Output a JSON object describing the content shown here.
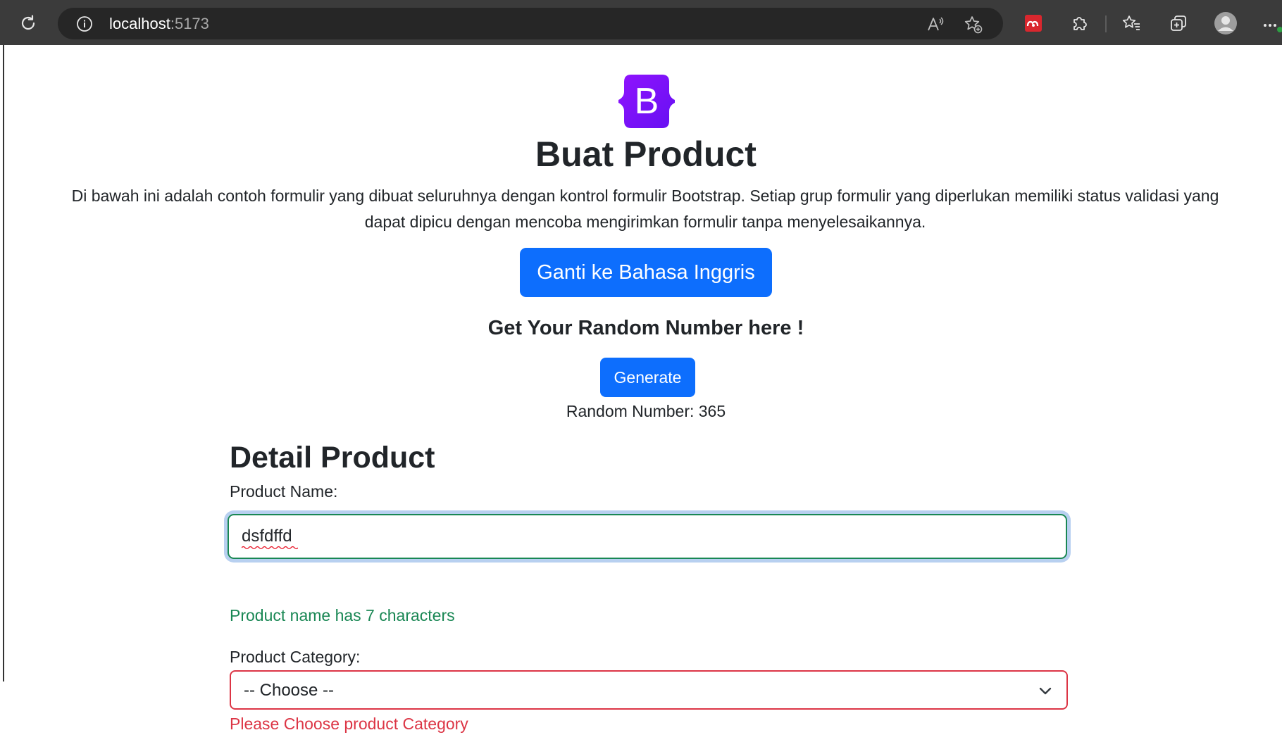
{
  "browser": {
    "url_host": "localhost",
    "url_port": ":5173",
    "icons": {
      "reload": "reload-icon",
      "site_info": "info-icon",
      "read_aloud": "read-aloud-icon",
      "add_favorite": "add-favorite-icon",
      "extension": "mendeley-extension-icon",
      "extensions": "extensions-puzzle-icon",
      "favorites": "favorites-icon",
      "collections": "collections-icon",
      "profile": "profile-avatar-icon",
      "menu": "more-menu-icon"
    }
  },
  "header": {
    "logo_letter": "B",
    "title": "Buat Product",
    "description": "Di bawah ini adalah contoh formulir yang dibuat seluruhnya dengan kontrol formulir Bootstrap. Setiap grup formulir yang diperlukan memiliki status validasi yang dapat dipicu dengan mencoba mengirimkan formulir tanpa menyelesaikannya.",
    "language_button": "Ganti ke Bahasa Inggris"
  },
  "random": {
    "heading": "Get Your Random Number here !",
    "button": "Generate",
    "result": "Random Number: 365"
  },
  "form": {
    "section_title": "Detail Product",
    "name_label": "Product Name:",
    "name_value": "dsfdffd",
    "name_feedback": "Product name has 7 characters",
    "category_label": "Product Category:",
    "category_value": "-- Choose --",
    "category_feedback": "Please Choose product Category"
  },
  "colors": {
    "primary": "#0d6efd",
    "bootstrap_purple": "#7a12f2",
    "valid": "#198754",
    "invalid": "#dc3545",
    "browser_chrome": "#3b3b3b"
  }
}
